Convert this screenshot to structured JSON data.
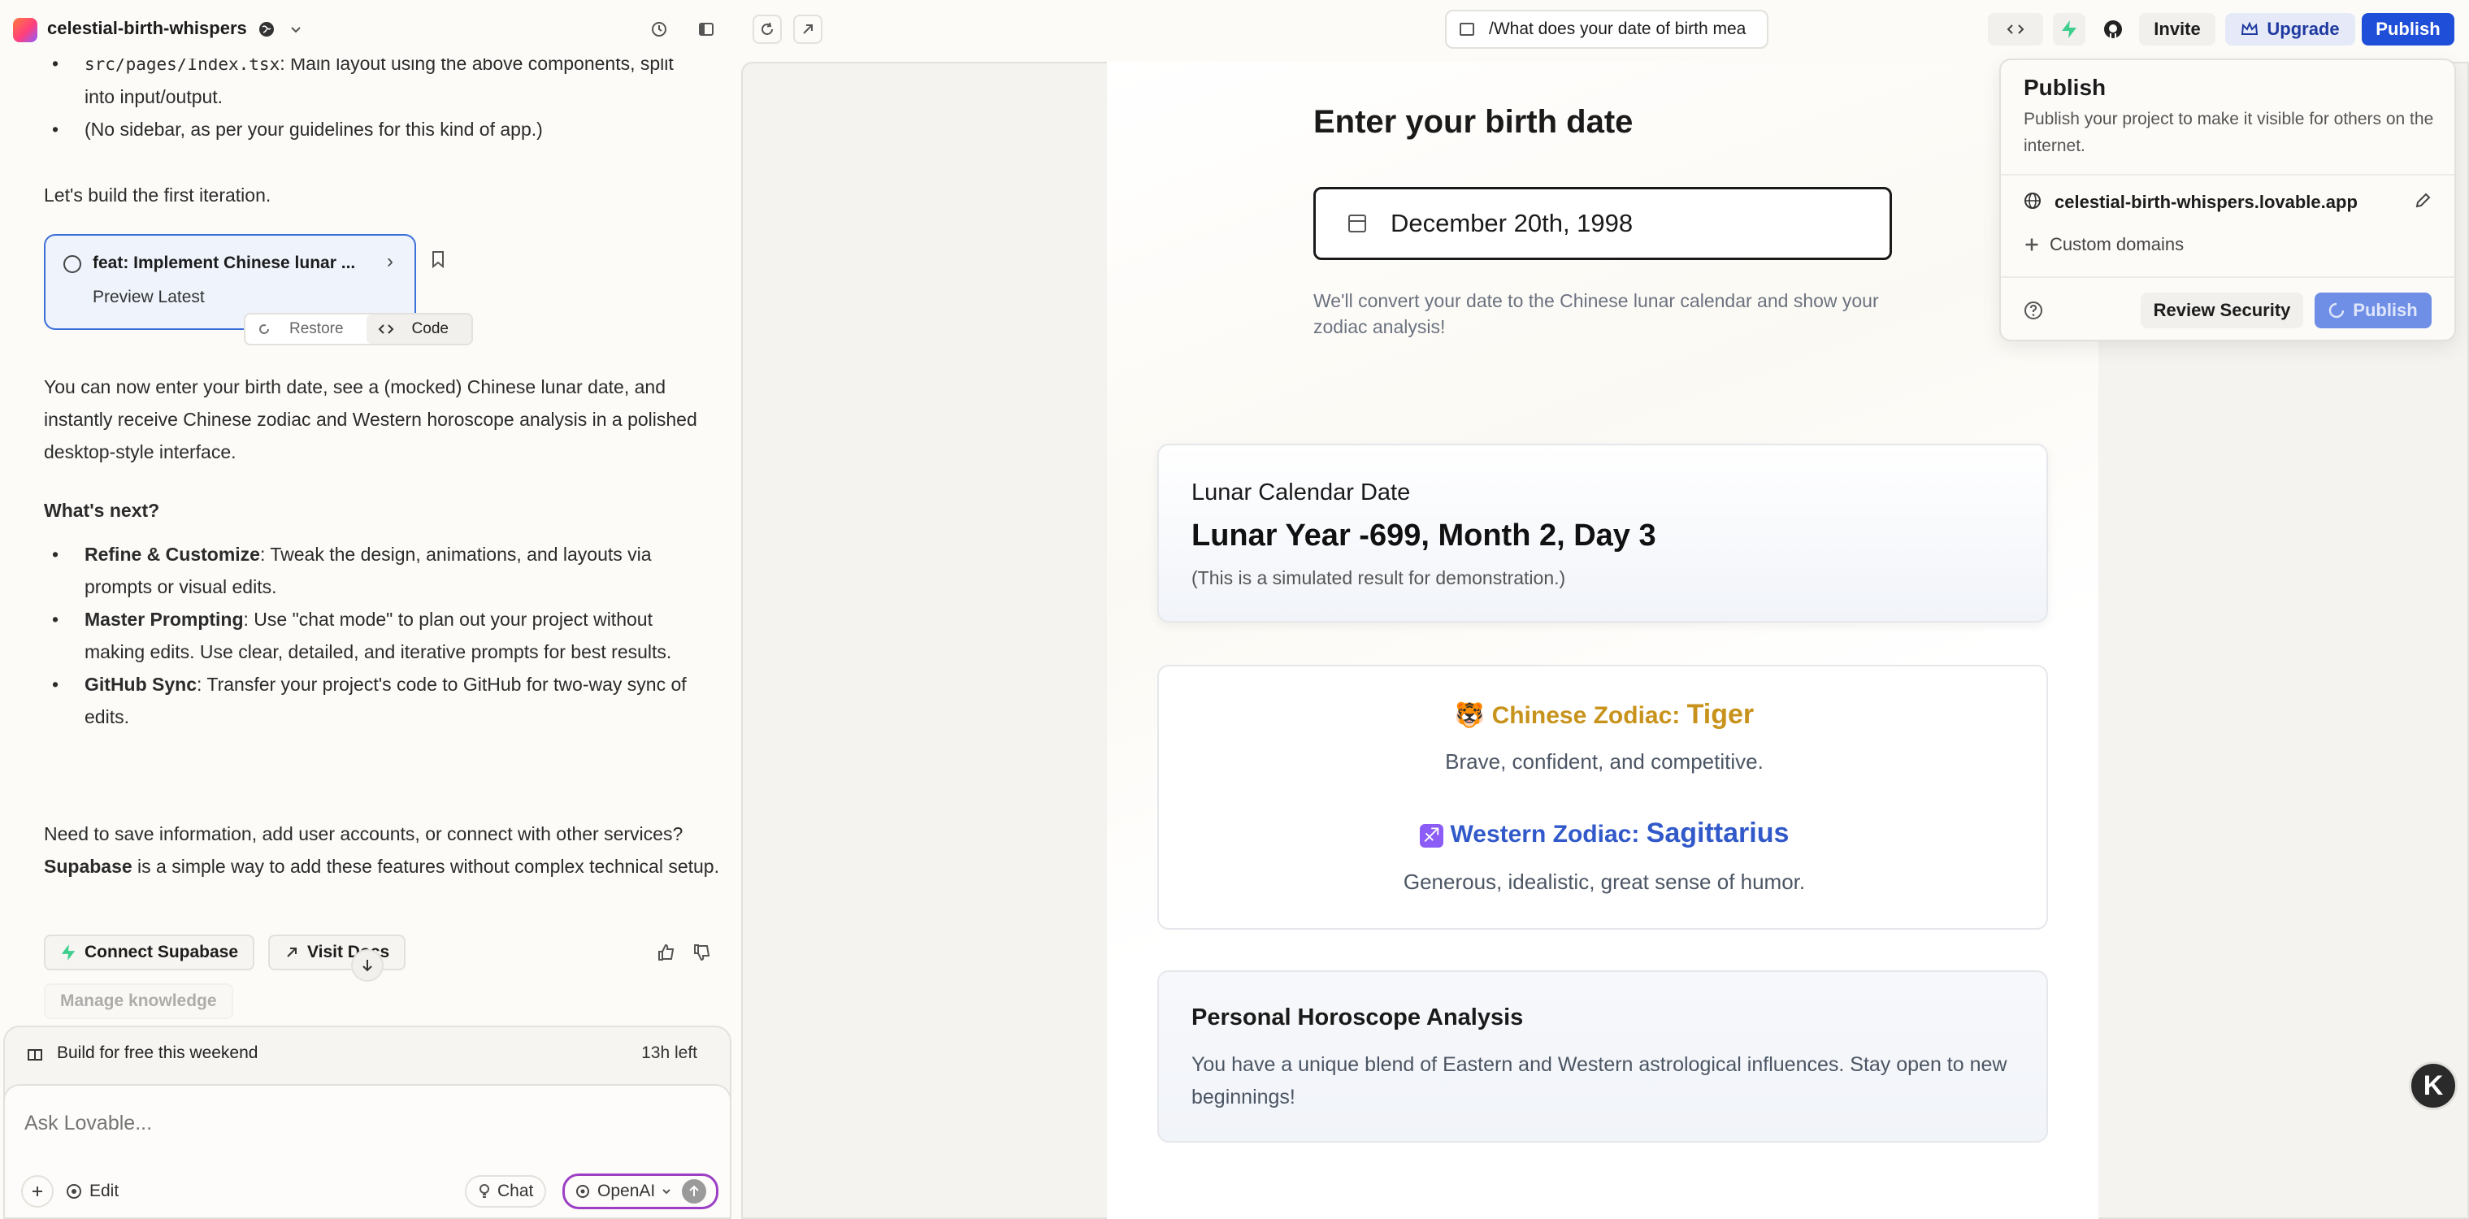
{
  "header": {
    "project_name": "celestial-birth-whispers",
    "url_path": "/What does your date of birth mea",
    "invite_label": "Invite",
    "upgrade_label": "Upgrade",
    "publish_label": "Publish"
  },
  "chat": {
    "bullets_top": [
      {
        "code": "src/pages/Index.tsx",
        "text": ": Main layout using the above components, split into input/output."
      },
      {
        "code": "",
        "text": "(No sidebar, as per your guidelines for this kind of app.)"
      }
    ],
    "lets_build": "Let's build the first iteration.",
    "commit_card": {
      "title": "feat: Implement Chinese lunar ...",
      "subtitle": "Preview Latest",
      "restore_label": "Restore",
      "code_label": "Code"
    },
    "summary": "You can now enter your birth date, see a (mocked) Chinese lunar date, and instantly receive Chinese zodiac and Western horoscope analysis in a polished desktop-style interface.",
    "whats_next": "What's next?",
    "next_items": [
      {
        "bold": "Refine & Customize",
        "text": ": Tweak the design, animations, and layouts via prompts or visual edits."
      },
      {
        "bold": "Master Prompting",
        "text": ": Use \"chat mode\" to plan out your project without making edits. Use clear, detailed, and iterative prompts for best results."
      },
      {
        "bold": "GitHub Sync",
        "text": ": Transfer your project's code to GitHub for two-way sync of edits."
      }
    ],
    "supabase_pre": "Need to save information, add user accounts, or connect with other services? ",
    "supabase_bold": "Supabase",
    "supabase_post": " is a simple way to add these features without complex technical setup.",
    "connect_supabase": "Connect Supabase",
    "visit_docs": "Visit Docs",
    "manage_knowledge": "Manage knowledge",
    "promo_text": "Build for free this weekend",
    "promo_time": "13h left",
    "placeholder": "Ask Lovable...",
    "edit_label": "Edit",
    "chat_label": "Chat",
    "model_label": "OpenAI"
  },
  "preview": {
    "heading": "Enter your birth date",
    "date_value": "December 20th, 1998",
    "helper": "We'll convert your date to the Chinese lunar calendar and show your zodiac analysis!",
    "lunar_title": "Lunar Calendar Date",
    "lunar_value": "Lunar Year -699, Month 2, Day 3",
    "lunar_note": "(This is a simulated result for demonstration.)",
    "chinese_emoji": "🐯",
    "chinese_label": "Chinese Zodiac:",
    "chinese_sign": "Tiger",
    "chinese_desc": "Brave, confident, and competitive.",
    "western_emoji": "♐",
    "western_label": "Western Zodiac:",
    "western_sign": "Sagittarius",
    "western_desc": "Generous, idealistic, great sense of humor.",
    "horoscope_title": "Personal Horoscope Analysis",
    "horoscope_text": "You have a unique blend of Eastern and Western astrological influences. Stay open to new beginnings!"
  },
  "publish_popover": {
    "title": "Publish",
    "description": "Publish your project to make it visible for others on the internet.",
    "domain": "celestial-birth-whispers.lovable.app",
    "custom_domains": "Custom domains",
    "review_security": "Review Security",
    "publish_button": "Publish"
  },
  "colors": {
    "accent_blue": "#1f4ed8",
    "zodiac_gold": "#c8931c",
    "zodiac_blue": "#3159c9",
    "supabase_green": "#3ecf8e"
  },
  "icons": [
    "globe-icon",
    "chevron-down-icon",
    "history-icon",
    "sidebar-icon",
    "refresh-icon",
    "external-link-icon",
    "book-icon",
    "code-icon",
    "supabase-icon",
    "github-icon",
    "crown-icon",
    "calendar-icon",
    "pencil-icon",
    "plus-icon",
    "help-icon",
    "spinner-icon",
    "bookmark-icon",
    "thumbs-up-icon",
    "thumbs-down-icon",
    "arrow-down-icon",
    "gift-icon",
    "arrow-up-icon",
    "lightbulb-icon"
  ]
}
